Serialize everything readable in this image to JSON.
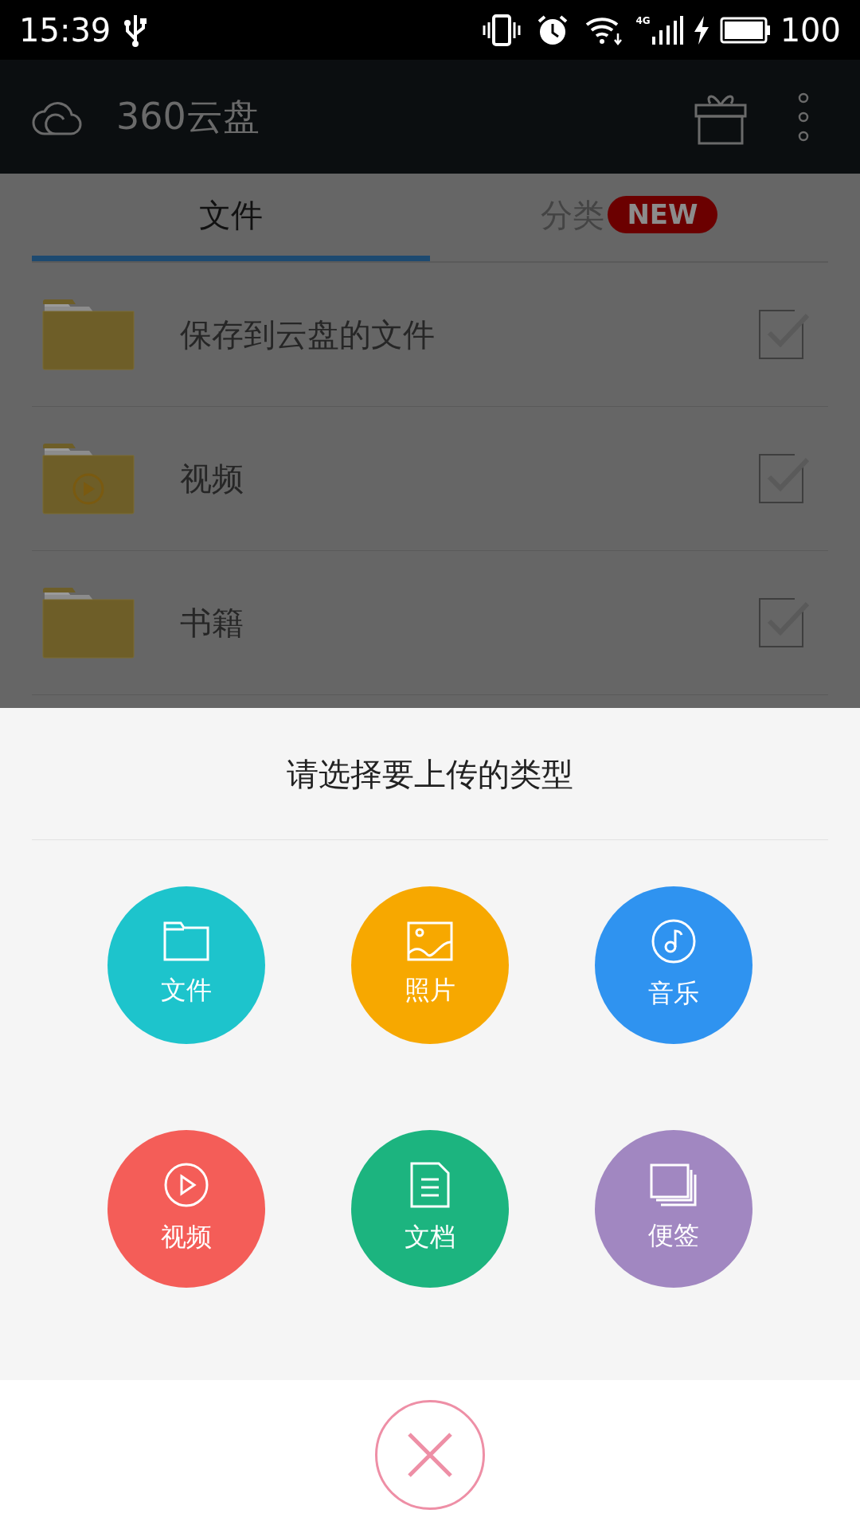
{
  "status_bar": {
    "time": "15:39",
    "network": "4G",
    "battery": "100"
  },
  "app_bar": {
    "title": "360云盘"
  },
  "tabs": [
    {
      "label": "文件",
      "selected": true
    },
    {
      "label": "分类",
      "selected": false,
      "badge": "NEW"
    }
  ],
  "folders": [
    {
      "name": "保存到云盘的文件",
      "kind": "plain",
      "checked": false
    },
    {
      "name": "视频",
      "kind": "video",
      "checked": false
    },
    {
      "name": "书籍",
      "kind": "plain",
      "checked": false
    }
  ],
  "upload_sheet": {
    "title": "请选择要上传的类型",
    "options": [
      {
        "label": "文件",
        "kind": "file",
        "color": "#1dc4cc"
      },
      {
        "label": "照片",
        "kind": "photo",
        "color": "#f7a800"
      },
      {
        "label": "音乐",
        "kind": "music",
        "color": "#2f93f0"
      },
      {
        "label": "视频",
        "kind": "video",
        "color": "#f45d58"
      },
      {
        "label": "文档",
        "kind": "document",
        "color": "#1cb47f"
      },
      {
        "label": "便签",
        "kind": "note",
        "color": "#a187c1"
      }
    ]
  }
}
